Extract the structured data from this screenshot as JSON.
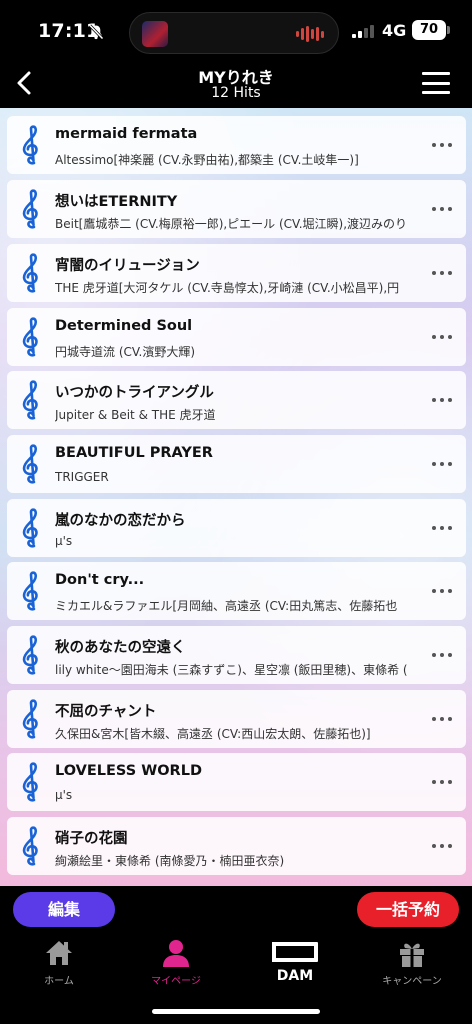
{
  "status": {
    "time": "17:11",
    "network": "4G",
    "battery": "70"
  },
  "header": {
    "title": "MYりれき",
    "subtitle": "12 Hits"
  },
  "songs": [
    {
      "title": "mermaid fermata",
      "artist": "Altessimo[神楽麗 (CV.永野由祐),都築圭 (CV.土岐隼一)]"
    },
    {
      "title": "想いはETERNITY",
      "artist": "Beit[鷹城恭二 (CV.梅原裕一郎),ピエール (CV.堀江瞬),渡辺みのり"
    },
    {
      "title": "宵闇のイリュージョン",
      "artist": "THE 虎牙道[大河タケル (CV.寺島惇太),牙崎漣 (CV.小松昌平),円"
    },
    {
      "title": "Determined Soul",
      "artist": "円城寺道流 (CV.濱野大輝)"
    },
    {
      "title": "いつかのトライアングル",
      "artist": "Jupiter & Beit & THE 虎牙道"
    },
    {
      "title": "BEAUTIFUL PRAYER",
      "artist": "TRIGGER"
    },
    {
      "title": "嵐のなかの恋だから",
      "artist": "μ's"
    },
    {
      "title": "Don't cry...",
      "artist": "ミカエル&ラファエル[月岡紬、高遠丞 (CV:田丸篤志、佐藤拓也"
    },
    {
      "title": "秋のあなたの空遠く",
      "artist": "lily white～園田海未 (三森すずこ)、星空凛 (飯田里穂)、東條希 ("
    },
    {
      "title": "不屈のチャント",
      "artist": "久保田&宮木[皆木綴、高遠丞 (CV:西山宏太朗、佐藤拓也)]"
    },
    {
      "title": "LOVELESS WORLD",
      "artist": "μ's"
    },
    {
      "title": "硝子の花園",
      "artist": "絢瀬絵里・東條希 (南條愛乃・楠田亜衣奈)"
    }
  ],
  "actions": {
    "edit_label": "編集",
    "bulk_label": "一括予約"
  },
  "tabs": [
    {
      "label": "ホーム",
      "icon": "home-icon"
    },
    {
      "label": "マイページ",
      "icon": "person-icon"
    },
    {
      "label": "DAM",
      "icon": "dam-logo"
    },
    {
      "label": "キャンペーン",
      "icon": "gift-icon"
    }
  ],
  "colors": {
    "accent_purple": "#5b3be8",
    "accent_red": "#e8202a",
    "active_tab": "#e0258f",
    "note_blue": "#1a63d6"
  }
}
